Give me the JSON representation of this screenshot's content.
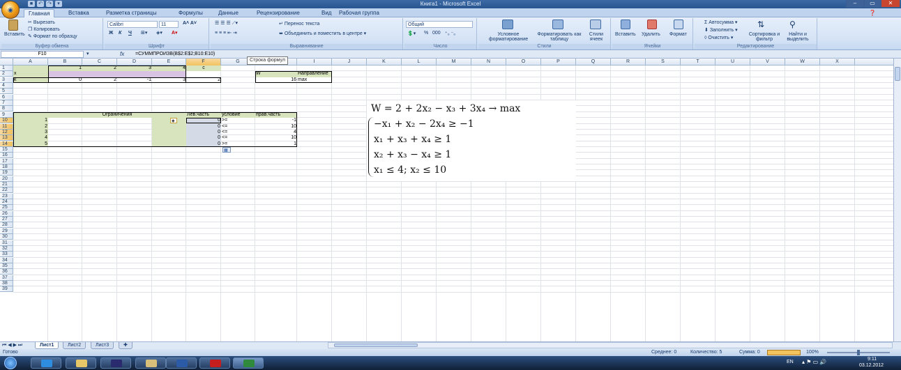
{
  "window": {
    "title": "Книга1 - Microsoft Excel",
    "minimize": "–",
    "maximize": "▭",
    "close": "✕"
  },
  "ribbon_tabs": [
    "Главная",
    "Вставка",
    "Разметка страницы",
    "Формулы",
    "Данные",
    "Рецензирование",
    "Вид",
    "Рабочая группа"
  ],
  "ribbon": {
    "clipboard": {
      "paste": "Вставить",
      "cut": "Вырезать",
      "copy": "Копировать",
      "format_painter": "Формат по образцу",
      "label": "Буфер обмена"
    },
    "font": {
      "name": "Calibri",
      "size": "11",
      "bold": "Ж",
      "italic": "К",
      "underline": "Ч",
      "label": "Шрифт"
    },
    "alignment": {
      "wrap": "Перенос текста",
      "merge": "Объединить и поместить в центре",
      "label": "Выравнивание"
    },
    "number": {
      "format": "Общий",
      "percent": "%",
      "thousands": "000",
      "label": "Число"
    },
    "styles": {
      "conditional": "Условное форматирование",
      "as_table": "Форматировать как таблицу",
      "cell_styles": "Стили ячеек",
      "label": "Стили"
    },
    "cells": {
      "insert": "Вставить",
      "delete": "Удалить",
      "format": "Формат",
      "label": "Ячейки"
    },
    "editing": {
      "autosum": "Автосумма",
      "fill": "Заполнить",
      "clear": "Очистить",
      "sort": "Сортировка и фильтр",
      "find": "Найти и выделить",
      "label": "Редактирование"
    }
  },
  "formula_bar": {
    "name_box": "F10",
    "fx": "fx",
    "formula": "=СУММПРОИЗВ(B$2:E$2;B10:E10)",
    "tooltip": "Строка формул"
  },
  "columns": [
    "A",
    "B",
    "C",
    "D",
    "E",
    "F",
    "G",
    "H",
    "I",
    "J",
    "K",
    "L",
    "M",
    "N",
    "O",
    "P",
    "Q",
    "R",
    "S",
    "T",
    "U",
    "V",
    "W",
    "X"
  ],
  "rows": [
    "1",
    "2",
    "3",
    "4",
    "5",
    "6",
    "7",
    "8",
    "9",
    "10",
    "11",
    "12",
    "13",
    "14",
    "15",
    "16",
    "17",
    "18",
    "19",
    "20",
    "21",
    "22",
    "23",
    "24",
    "25",
    "26",
    "27",
    "28",
    "29",
    "30",
    "31",
    "32",
    "33",
    "34",
    "35",
    "36",
    "37",
    "38",
    "39"
  ],
  "cells": {
    "B1": "1",
    "C1": "2",
    "D1": "3",
    "E1": "4",
    "F1": "c",
    "A2": "x",
    "A3": "k",
    "B3": "0",
    "C3": "2",
    "D3": "-1",
    "E3": "3",
    "F3": "2",
    "H2": "W",
    "I2": "Направление",
    "H3": "16",
    "I3": "max",
    "B9": "Ограничения",
    "F9": "Лев.часть",
    "G9": "условие",
    "H9": "прав.часть",
    "A10": "1",
    "F10": "0",
    "G10": ">=",
    "H10": "-1",
    "A11": "2",
    "F11": "0",
    "G11": "<=",
    "H11": "10",
    "A12": "3",
    "F12": "0",
    "G12": "<=",
    "H12": "4",
    "A13": "4",
    "F13": "0",
    "G13": "<=",
    "H13": "10",
    "A14": "5",
    "F14": "0",
    "G14": ">=",
    "H14": "1"
  },
  "math": {
    "objective": "W = 2 + 2x₂ − x₃ + 3x₄ → max",
    "c1": "−x₁ + x₂ − 2x₄ ≥ −1",
    "c2": "x₁ + x₃ + x₄ ≥ 1",
    "c3": "x₂ + x₃ − x₄ ≥ 1",
    "c4": "x₁ ≤ 4; x₂ ≤ 10"
  },
  "sheet_tabs": [
    "Лист1",
    "Лист2",
    "Лист3"
  ],
  "status": {
    "ready": "Готово",
    "average": "Среднее: 0",
    "count": "Количество: 5",
    "sum": "Сумма: 0",
    "zoom": "100%"
  },
  "taskbar": {
    "lang": "EN",
    "time": "9:11",
    "date": "03.12.2012"
  },
  "colors": {
    "green_fill": "#d7e4bd",
    "purple_fill": "#d9c3e3",
    "selected_header": "#f1c15f",
    "ribbon": "#d5e3f6"
  }
}
